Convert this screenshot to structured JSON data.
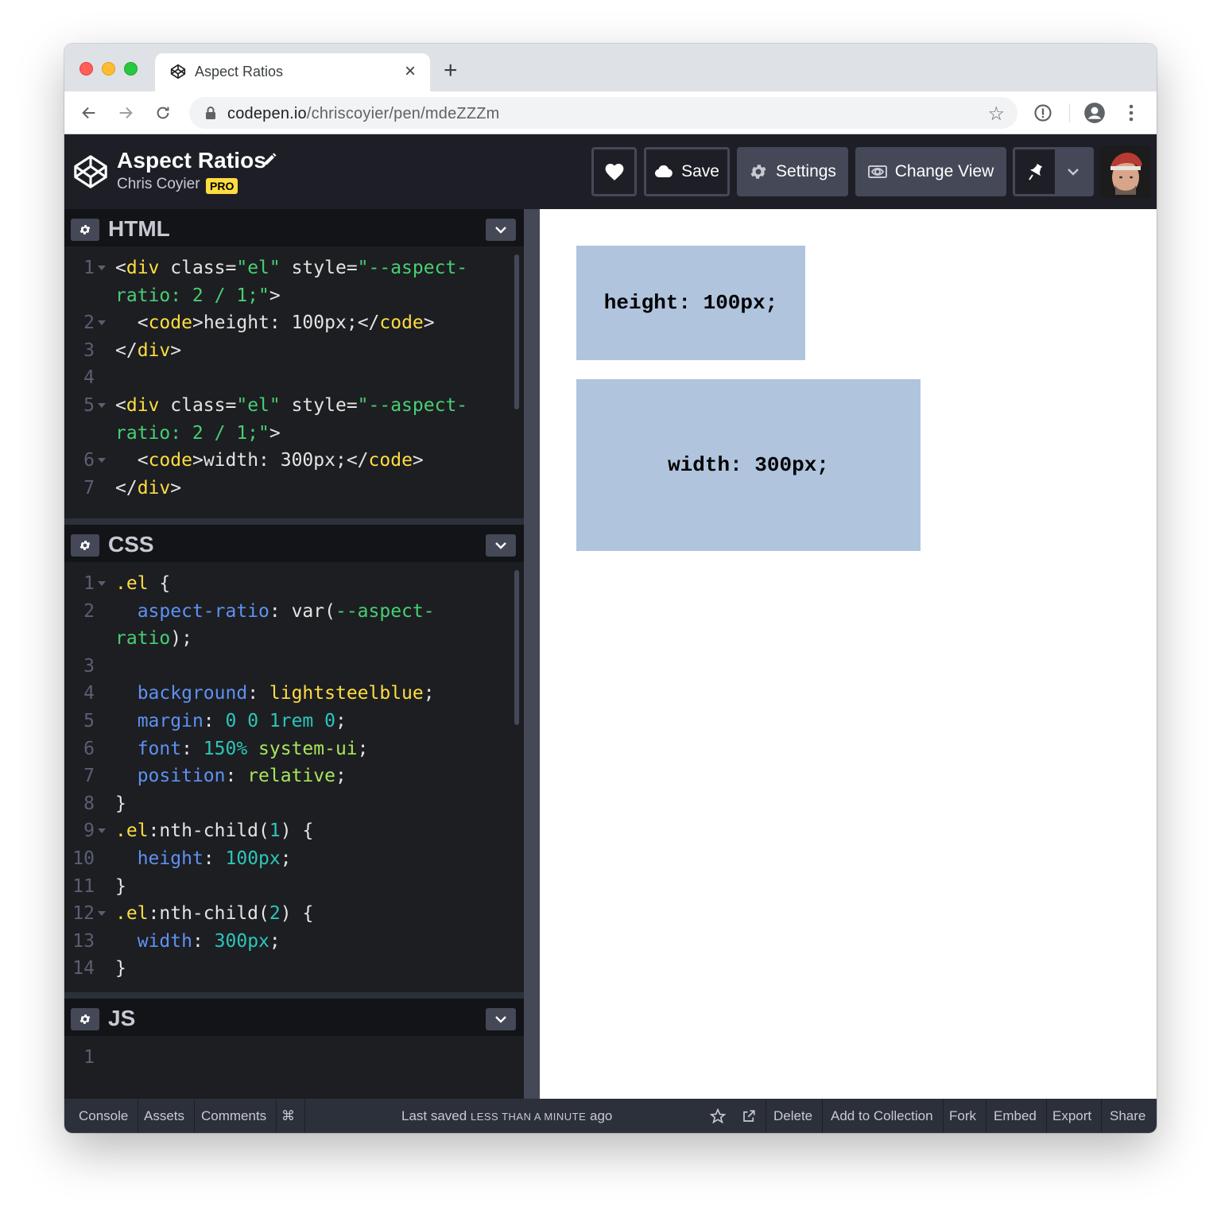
{
  "browser": {
    "tab_title": "Aspect Ratios",
    "tab_close": "×",
    "new_tab": "+",
    "url_domain": "codepen.io",
    "url_path": "/chriscoyier/pen/mdeZZZm"
  },
  "header": {
    "pen_title": "Aspect Ratios",
    "author": "Chris Coyier",
    "badge": "PRO",
    "save_label": "Save",
    "settings_label": "Settings",
    "change_view_label": "Change View"
  },
  "html_panel": {
    "name": "HTML",
    "lines": [
      {
        "n": "1",
        "fold": true
      },
      {
        "n": "",
        "fold": false
      },
      {
        "n": "2",
        "fold": true
      },
      {
        "n": "3",
        "fold": false
      },
      {
        "n": "4",
        "fold": false
      },
      {
        "n": "5",
        "fold": true
      },
      {
        "n": "",
        "fold": false
      },
      {
        "n": "6",
        "fold": true
      },
      {
        "n": "7",
        "fold": false
      }
    ]
  },
  "css_panel": {
    "name": "CSS",
    "line_numbers": [
      "1",
      "2",
      "",
      "3",
      "4",
      "5",
      "6",
      "7",
      "8",
      "9",
      "10",
      "11",
      "12",
      "13",
      "14"
    ]
  },
  "js_panel": {
    "name": "JS",
    "line_numbers": [
      "1"
    ]
  },
  "code_text": {
    "div_open": "<",
    "div": "div",
    "class_attr": " class=",
    "el_str": "\"el\"",
    "style_attr": " style=",
    "aspect_str_a": "\"--aspect-",
    "aspect_str_b": "ratio: 2 / 1;\"",
    "gt": ">",
    "code_tag": "code",
    "height_text": "height: 100px;",
    "width_text": "width: 300px;",
    "close_lt": "</",
    "sel_el": ".el",
    "brace_open": " {",
    "brace_close": "}",
    "prop_aspect": "aspect-ratio",
    "colon": ": ",
    "var_open": "var(",
    "var_name_a": "--aspect-",
    "var_name_b": "ratio",
    "paren_semi": ");",
    "prop_background": "background",
    "val_background": "lightsteelblue",
    "semi": ";",
    "prop_margin": "margin",
    "val_margin": "0 0 1rem 0",
    "prop_font": "font",
    "val_font_pct": "150%",
    "val_font_family": " system-ui",
    "prop_position": "position",
    "val_position": "relative",
    "nth_child": ":nth-child(",
    "one": "1",
    "two": "2",
    "paren_close": ")",
    "prop_height": "height",
    "val_100px": "100px",
    "prop_width": "width",
    "val_300px": "300px"
  },
  "preview": {
    "box1_text": "height: 100px;",
    "box2_text": "width: 300px;",
    "box_color": "#b0c4de"
  },
  "footer": {
    "console": "Console",
    "assets": "Assets",
    "comments": "Comments",
    "shortcut": "⌘",
    "saved_prefix": "Last saved",
    "saved_time": "LESS THAN A MINUTE",
    "saved_suffix": "ago",
    "delete": "Delete",
    "add_to_collection": "Add to Collection",
    "fork": "Fork",
    "embed": "Embed",
    "export": "Export",
    "share": "Share"
  },
  "colors": {
    "header_bg": "#1e1f26",
    "editor_bg": "#1d1e22",
    "panel_head_bg": "#131417",
    "button_bg": "#444857",
    "pro_yellow": "#ffdd40"
  }
}
